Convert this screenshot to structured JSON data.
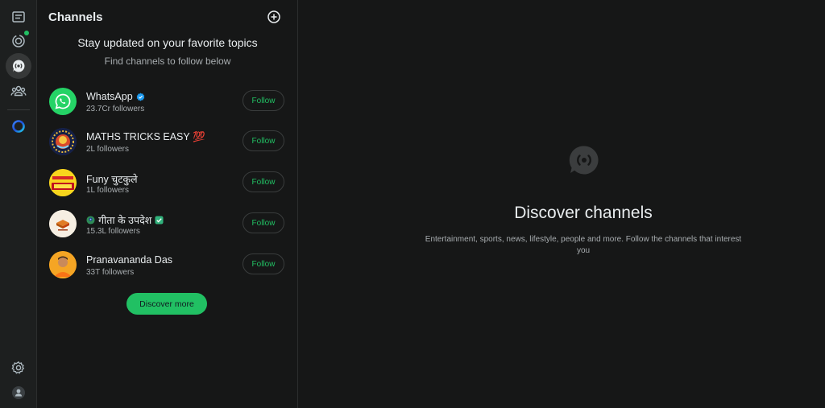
{
  "rail": {
    "icons": [
      "chats-icon",
      "status-icon",
      "channels-icon",
      "communities-icon",
      "meta-ai-icon",
      "settings-icon",
      "profile-icon"
    ],
    "accent": "#21c063"
  },
  "panel": {
    "title": "Channels",
    "headline": "Stay updated on your favorite topics",
    "subtitle": "Find channels to follow below",
    "channels": [
      {
        "name": "WhatsApp",
        "followers": "23.7Cr followers",
        "follow_label": "Follow",
        "badge": "verified-icon"
      },
      {
        "name": "MATHS TRICKS EASY 💯",
        "followers": "2L followers",
        "follow_label": "Follow",
        "badge": ""
      },
      {
        "name": "Funy चुटकुले",
        "followers": "1L followers",
        "follow_label": "Follow",
        "badge": ""
      },
      {
        "name": "गीता के उपदेश",
        "followers": "15.3L followers",
        "follow_label": "Follow",
        "badge": "check-icon"
      },
      {
        "name": "Pranavananda Das",
        "followers": "33T followers",
        "follow_label": "Follow",
        "badge": ""
      }
    ],
    "discover_more_label": "Discover more"
  },
  "main": {
    "title": "Discover channels",
    "description": "Entertainment, sports, news, lifestyle, people and more. Follow the channels that interest you"
  }
}
